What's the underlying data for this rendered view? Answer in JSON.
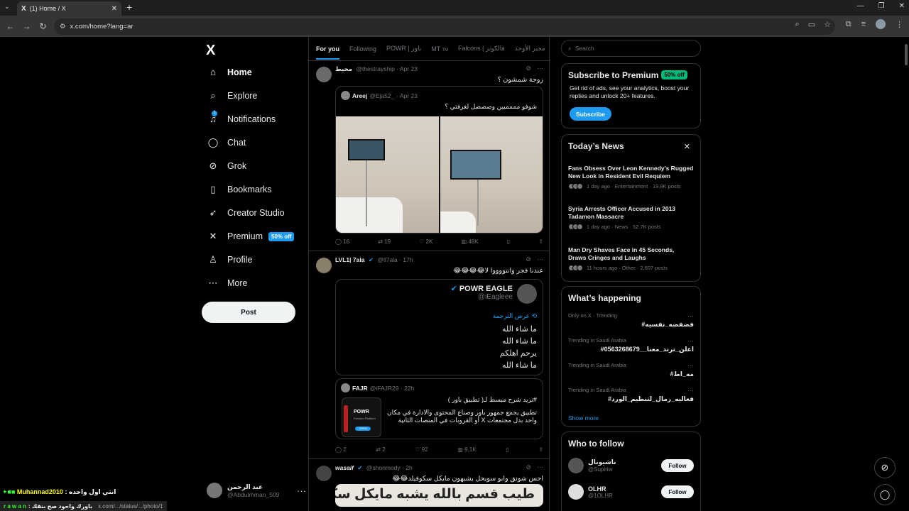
{
  "browser": {
    "tab_title": "(1) Home / X",
    "tab_favicon": "X",
    "url": "x.com/home?lang=ar",
    "status_url": "x.com/.../status/.../photo/1"
  },
  "nav": {
    "logo": "X",
    "items": [
      {
        "label": "Home",
        "icon": "home-icon",
        "glyph": "⌂"
      },
      {
        "label": "Explore",
        "icon": "search-icon",
        "glyph": "⌕"
      },
      {
        "label": "Notifications",
        "icon": "bell-icon",
        "glyph": "🔔"
      },
      {
        "label": "Chat",
        "icon": "chat-icon",
        "glyph": "◯"
      },
      {
        "label": "Grok",
        "icon": "grok-icon",
        "glyph": "⊘"
      },
      {
        "label": "Bookmarks",
        "icon": "bookmark-icon",
        "glyph": "▯"
      },
      {
        "label": "Creator Studio",
        "icon": "rocket-icon",
        "glyph": "➶"
      },
      {
        "label": "Premium",
        "icon": "x-premium-icon",
        "glyph": "✕",
        "badge": "50% off"
      },
      {
        "label": "Profile",
        "icon": "person-icon",
        "glyph": "♙"
      },
      {
        "label": "More",
        "icon": "more-circle-icon",
        "glyph": "⋯"
      }
    ],
    "notif_count": "1",
    "post_label": "Post"
  },
  "account": {
    "name": "عبد الرحمن",
    "handle": "@Abdulrhman_509"
  },
  "feed_tabs": [
    "For you",
    "Following",
    "POWR | باور",
    "MT",
    "Falcons | فالكونز",
    "مجير الأوحد"
  ],
  "feed_tab_badge": "TM",
  "tweets": [
    {
      "name": "محيط",
      "handle": "@thestrayship",
      "time": "Apr 23",
      "text": "زوجة شمشون ؟",
      "quote": {
        "name": "Areej",
        "handle": "@Eja52_",
        "time": "Apr 23",
        "text": "شوفو مممميين وصصصل لغرفتي ؟"
      },
      "stats": {
        "replies": "16",
        "reposts": "19",
        "likes": "2K",
        "views": "48K"
      }
    },
    {
      "name": "LVL1| 7ala",
      "handle": "@ll7ala",
      "time": "17h",
      "text": "عندنا فجر وانتووووا لا😂😂😂😂",
      "quote": {
        "name": "POWR EAGLE",
        "handle": "@iEagleee",
        "translate": "عرض الترجمة",
        "lines": [
          "ما شاء الله",
          "ما شاء الله",
          "يرحم اهلكم",
          "ما شاء الله"
        ]
      },
      "inner_quote": {
        "name": "FAJR",
        "handle": "@iFAJR29",
        "time": "22h",
        "title": "#تريد شرح مبسط لـ( تطبيق باور )",
        "body1": "تطبيق يجمع جمهور باور وصناع المحتوى والادارة في مكان",
        "body2": "واحد بدل مجتمعات X أو القروبات في المنصات الثانية",
        "thumb_title": "POWR",
        "thumb_sub": "Fandom Platform",
        "thumb_btn": "OPEN"
      },
      "stats": {
        "replies": "2",
        "reposts": "2",
        "likes": "92",
        "views": "9.1K"
      }
    },
    {
      "name": "wasaif",
      "handle": "@shonmody",
      "time": "2h",
      "text": "احس شونق وابو سويحل يشبهون مايكل سكوفيلد😂😂",
      "banner": "طيب قسم بالله يشبه مايكل سكوفيلد!"
    }
  ],
  "search": {
    "placeholder": "Search"
  },
  "premium": {
    "title": "Subscribe to Premium",
    "badge": "50% off",
    "desc": "Get rid of ads, see your analytics, boost your replies and unlock 20+ features.",
    "button": "Subscribe"
  },
  "news": {
    "title": "Today’s News",
    "items": [
      {
        "title": "Fans Obsess Over Leon Kennedy's Rugged New Look in Resident Evil Requiem",
        "meta": "1 day ago · Entertainment · 19.8K posts"
      },
      {
        "title": "Syria Arrests Officer Accused in 2013 Tadamon Massacre",
        "meta": "1 day ago · News · 52.7K posts"
      },
      {
        "title": "Man Dry Shaves Face in 45 Seconds, Draws Cringes and Laughs",
        "meta": "11 hours ago · Other · 2,607 posts"
      }
    ]
  },
  "happening": {
    "title": "What’s happening",
    "trends": [
      {
        "context": "Only on X · Trending",
        "name": "#فضفضه_نفسيه"
      },
      {
        "context": "Trending in Saudi Arabia",
        "name": "#اعلن_ترند_معنا__0563268679"
      },
      {
        "context": "Trending in Saudi Arabia",
        "name": "#مه_اط"
      },
      {
        "context": "Trending in Saudi Arabia",
        "name": "#فعاليه_رمال_لتنظيم_الورد"
      }
    ],
    "show_more": "Show more"
  },
  "follow": {
    "title": "Who to follow",
    "users": [
      {
        "name": "ناشيونال",
        "handle": "@Supiriw",
        "button": "Follow"
      },
      {
        "name": "OLHR",
        "handle": "@1OLHR",
        "button": "Follow"
      }
    ]
  },
  "overlay": {
    "line1_name": "Muhannad2010",
    "line1_text": ": انتي اول واحده",
    "line2_name": "r a w a n",
    "line2_text": ": باورك واجود صح بنقك"
  }
}
